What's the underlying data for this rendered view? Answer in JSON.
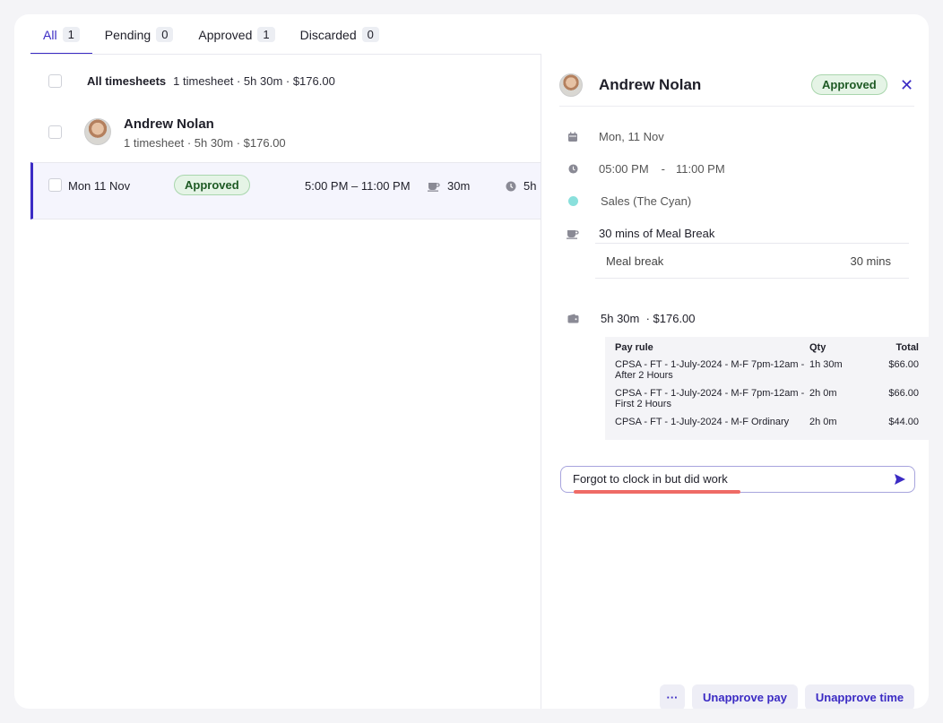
{
  "tabs": [
    {
      "label": "All",
      "count": "1"
    },
    {
      "label": "Pending",
      "count": "0"
    },
    {
      "label": "Approved",
      "count": "1"
    },
    {
      "label": "Discarded",
      "count": "0"
    }
  ],
  "list": {
    "all_label": "All timesheets",
    "all_summary": "1 timesheet · 5h 30m · $176.00",
    "person_name": "Andrew Nolan",
    "person_summary": "1 timesheet · 5h 30m · $176.00",
    "shift": {
      "date": "Mon 11 Nov",
      "status": "Approved",
      "time": "5:00 PM – 11:00 PM",
      "break": "30m",
      "duration": "5h"
    }
  },
  "detail": {
    "name": "Andrew Nolan",
    "status": "Approved",
    "date": "Mon, 11 Nov",
    "start": "05:00 PM",
    "separator": "-",
    "end": "11:00 PM",
    "team": "Sales (The Cyan)",
    "team_color": "#8ae0dc",
    "break_title": "30 mins of Meal Break",
    "break_item_label": "Meal break",
    "break_item_value": "30 mins",
    "pay_summary": "5h 30m  · $176.00",
    "pay_table": {
      "headers": [
        "Pay rule",
        "Qty",
        "Total"
      ],
      "rows": [
        [
          "CPSA - FT - 1-July-2024 - M-F 7pm-12am - After 2 Hours",
          "1h 30m",
          "$66.00"
        ],
        [
          "CPSA - FT - 1-July-2024 - M-F 7pm-12am - First 2 Hours",
          "2h 0m",
          "$66.00"
        ],
        [
          "CPSA - FT - 1-July-2024 - M-F Ordinary",
          "2h 0m",
          "$44.00"
        ]
      ]
    },
    "comment_value": "Forgot to clock in but did work",
    "buttons": {
      "more": "···",
      "unapprove_pay": "Unapprove pay",
      "unapprove_time": "Unapprove time"
    }
  },
  "colors": {
    "accent": "#3b2bc4",
    "approved_bg": "#e5f4e6",
    "approved_text": "#1e5a24",
    "annotation": "#ef6b66"
  }
}
